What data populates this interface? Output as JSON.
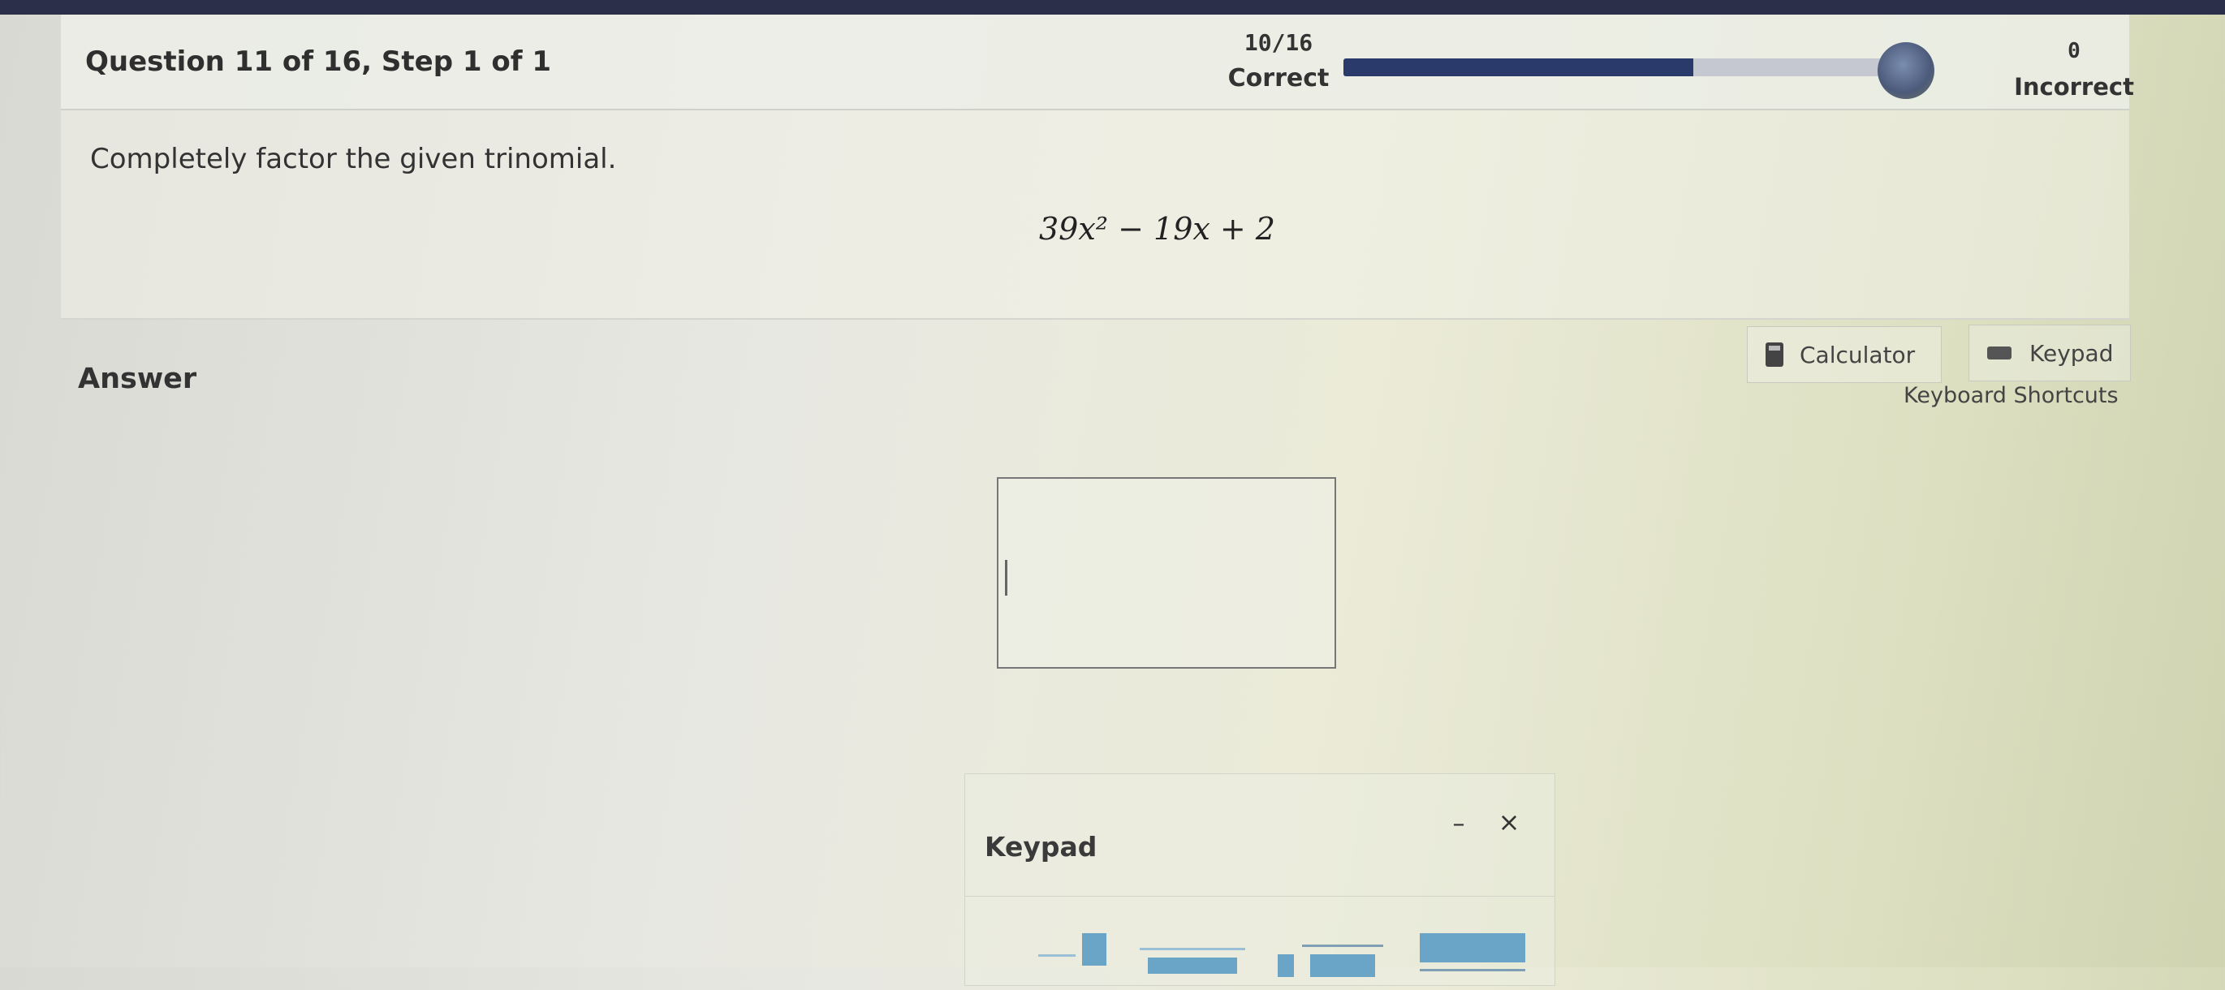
{
  "header": {
    "question_title": "Question 11 of 16,  Step 1 of 1",
    "correct_count": "10/16",
    "correct_label": "Correct",
    "progress_fraction": 0.625,
    "incorrect_count": "0",
    "incorrect_label": "Incorrect"
  },
  "prompt": {
    "instruction": "Completely factor the given trinomial.",
    "expression": "39x² − 19x + 2"
  },
  "answer": {
    "label": "Answer",
    "input_value": ""
  },
  "tools": {
    "calculator_label": "Calculator",
    "keypad_label": "Keypad",
    "shortcuts_label": "Keyboard Shortcuts"
  },
  "keypad": {
    "title": "Keypad",
    "minimize_glyph": "–",
    "close_glyph": "×"
  },
  "colors": {
    "progress_fill": "#2a3a6a",
    "keypad_accent": "#6aa5c8"
  }
}
